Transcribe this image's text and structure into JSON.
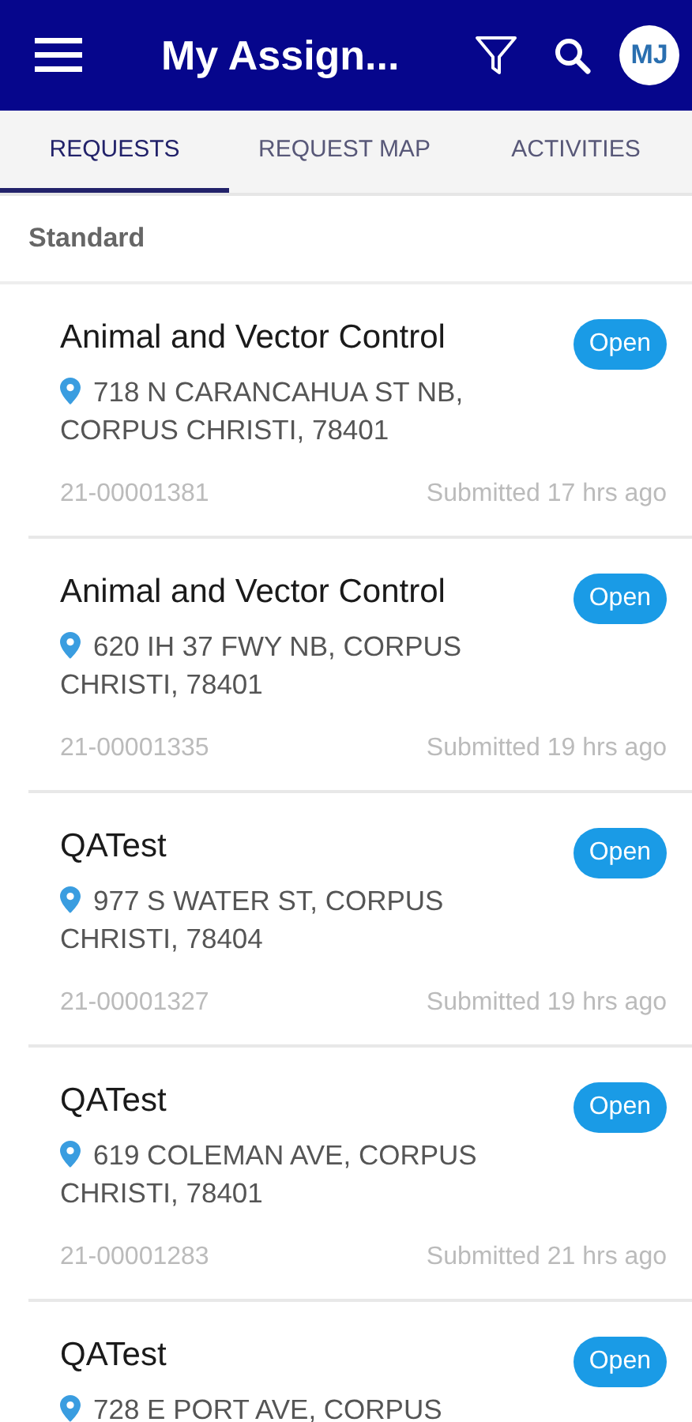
{
  "app_bar": {
    "title": "My Assign...",
    "avatar": "MJ"
  },
  "tabs": [
    {
      "label": "REQUESTS",
      "selected": true
    },
    {
      "label": "REQUEST MAP",
      "selected": false
    },
    {
      "label": "ACTIVITIES",
      "selected": false
    }
  ],
  "section": {
    "title": "Standard"
  },
  "requests": [
    {
      "title": "Animal and Vector Control",
      "status": "Open",
      "address_lines": [
        "718 N CARANCAHUA ST NB,",
        "CORPUS CHRISTI, 78401"
      ],
      "number": "21-00001381",
      "submitted": "Submitted 17 hrs ago"
    },
    {
      "title": "Animal and Vector Control",
      "status": "Open",
      "address_lines": [
        "620 IH 37 FWY NB, CORPUS",
        "CHRISTI, 78401"
      ],
      "number": "21-00001335",
      "submitted": "Submitted 19 hrs ago"
    },
    {
      "title": "QATest",
      "status": "Open",
      "address_lines": [
        "977 S WATER ST, CORPUS",
        "CHRISTI, 78404"
      ],
      "number": "21-00001327",
      "submitted": "Submitted 19 hrs ago"
    },
    {
      "title": "QATest",
      "status": "Open",
      "address_lines": [
        "619 COLEMAN AVE, CORPUS",
        "CHRISTI, 78401"
      ],
      "number": "21-00001283",
      "submitted": "Submitted 21 hrs ago"
    },
    {
      "title": "QATest",
      "status": "Open",
      "address_lines": [
        "728 E PORT AVE, CORPUS"
      ]
    }
  ]
}
